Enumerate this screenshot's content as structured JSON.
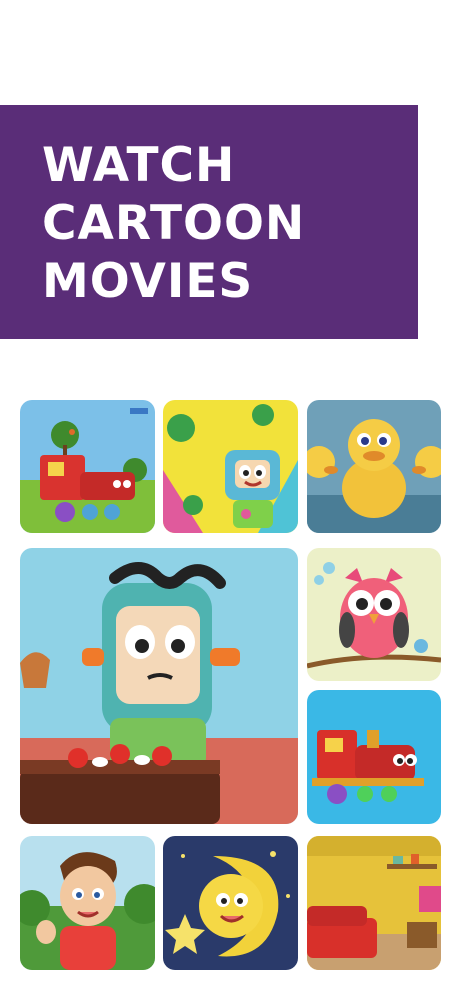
{
  "headline": {
    "lines": [
      "WATCH",
      "CARTOON",
      "MOVIES"
    ]
  },
  "colors": {
    "banner": "#5a2d78",
    "text": "#ffffff"
  },
  "gallery": [
    {
      "name": "thumb-red-train-garden",
      "icon": "train-illustration"
    },
    {
      "name": "thumb-robot-watermelon",
      "icon": "robot-illustration"
    },
    {
      "name": "thumb-yellow-ducklings",
      "icon": "duck-illustration"
    },
    {
      "name": "thumb-robot-cake",
      "icon": "robot-illustration"
    },
    {
      "name": "thumb-pink-owl",
      "icon": "owl-illustration"
    },
    {
      "name": "thumb-toy-train",
      "icon": "train-illustration"
    },
    {
      "name": "thumb-boy-waving",
      "icon": "boy-illustration"
    },
    {
      "name": "thumb-moon-star",
      "icon": "moon-illustration"
    },
    {
      "name": "thumb-living-room",
      "icon": "room-illustration"
    }
  ]
}
